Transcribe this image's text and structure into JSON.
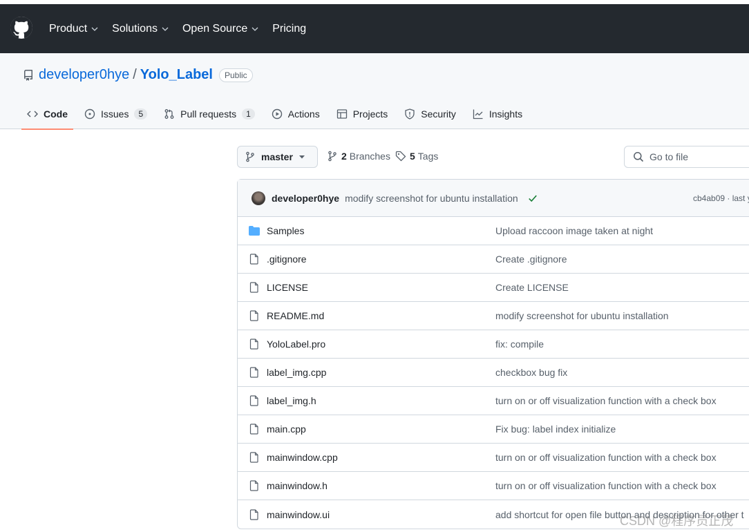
{
  "topnav": {
    "items": [
      {
        "label": "Product",
        "has_dropdown": true
      },
      {
        "label": "Solutions",
        "has_dropdown": true
      },
      {
        "label": "Open Source",
        "has_dropdown": true
      },
      {
        "label": "Pricing",
        "has_dropdown": false
      }
    ]
  },
  "repo": {
    "owner": "developer0hye",
    "separator": "/",
    "name": "Yolo_Label",
    "visibility": "Public"
  },
  "tabs": [
    {
      "label": "Code",
      "icon": "code-icon",
      "active": true
    },
    {
      "label": "Issues",
      "icon": "issue-icon",
      "count": "5"
    },
    {
      "label": "Pull requests",
      "icon": "pull-request-icon",
      "count": "1"
    },
    {
      "label": "Actions",
      "icon": "play-icon"
    },
    {
      "label": "Projects",
      "icon": "table-icon"
    },
    {
      "label": "Security",
      "icon": "shield-icon"
    },
    {
      "label": "Insights",
      "icon": "graph-icon"
    }
  ],
  "toolbar": {
    "branch": "master",
    "branches_count": "2",
    "branches_label": "Branches",
    "tags_count": "5",
    "tags_label": "Tags",
    "goto_placeholder": "Go to file"
  },
  "latest_commit": {
    "author": "developer0hye",
    "message": "modify screenshot for ubuntu installation",
    "hash_text": "cb4ab09 · last y"
  },
  "files": [
    {
      "name": "Samples",
      "type": "folder",
      "message": "Upload raccoon image taken at night"
    },
    {
      "name": ".gitignore",
      "type": "file",
      "message": "Create .gitignore"
    },
    {
      "name": "LICENSE",
      "type": "file",
      "message": "Create LICENSE"
    },
    {
      "name": "README.md",
      "type": "file",
      "message": "modify screenshot for ubuntu installation"
    },
    {
      "name": "YoloLabel.pro",
      "type": "file",
      "message": "fix: compile"
    },
    {
      "name": "label_img.cpp",
      "type": "file",
      "message": "checkbox bug fix"
    },
    {
      "name": "label_img.h",
      "type": "file",
      "message": "turn on or off visualization function with a check box"
    },
    {
      "name": "main.cpp",
      "type": "file",
      "message": "Fix bug: label index initialize"
    },
    {
      "name": "mainwindow.cpp",
      "type": "file",
      "message": "turn on or off visualization function with a check box"
    },
    {
      "name": "mainwindow.h",
      "type": "file",
      "message": "turn on or off visualization function with a check box"
    },
    {
      "name": "mainwindow.ui",
      "type": "file",
      "message": "add shortcut for open file button and description for other t"
    }
  ],
  "watermark": "CSDN @程序员正茂",
  "colors": {
    "header_bg": "#24292f",
    "link": "#0969da",
    "folder": "#54aeff",
    "success": "#1a7f37",
    "active_tab_underline": "#fd8c73"
  }
}
